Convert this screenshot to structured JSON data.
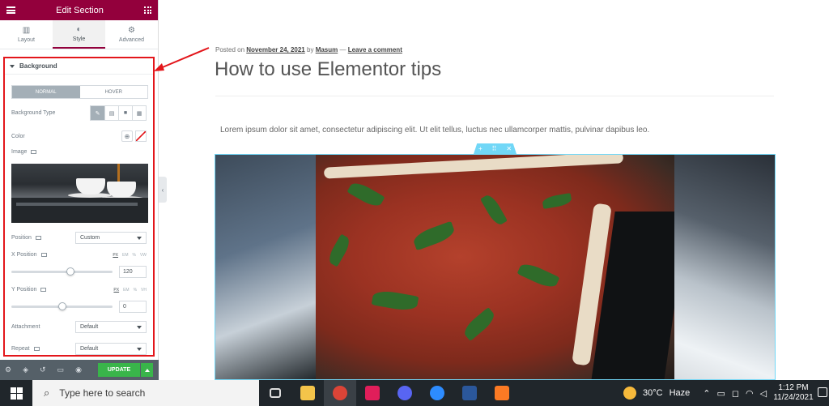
{
  "panel": {
    "header_title": "Edit Section",
    "tabs": [
      {
        "label": "Layout",
        "icon": "layout-icon"
      },
      {
        "label": "Style",
        "icon": "half-circle-icon"
      },
      {
        "label": "Advanced",
        "icon": "gear-icon"
      }
    ],
    "background": {
      "title": "Background",
      "state_tabs": [
        "NORMAL",
        "HOVER"
      ],
      "type_label": "Background Type",
      "color_label": "Color",
      "image_label": "Image",
      "position_label": "Position",
      "position_value": "Custom",
      "x_position_label": "X Position",
      "x_units": [
        "PX",
        "EM",
        "%",
        "VW"
      ],
      "x_value": "120",
      "x_slider_fraction": 0.58,
      "y_position_label": "Y Position",
      "y_units": [
        "PX",
        "EM",
        "%",
        "VH"
      ],
      "y_value": "0",
      "y_slider_fraction": 0.5,
      "attachment_label": "Attachment",
      "attachment_value": "Default",
      "repeat_label": "Repeat",
      "repeat_value": "Default"
    },
    "footer": {
      "update_label": "UPDATE"
    }
  },
  "post": {
    "posted_on": "Posted on",
    "date": "November 24, 2021",
    "by": "by",
    "author": "Masum",
    "dash": "—",
    "comment_link": "Leave a comment",
    "title": "How to use Elementor tips",
    "excerpt": "Lorem ipsum dolor sit amet, consectetur adipiscing elit. Ut elit tellus, luctus nec ullamcorper mattis, pulvinar dapibus leo."
  },
  "taskbar": {
    "search_placeholder": "Type here to search",
    "weather_temp": "30°C",
    "weather_desc": "Haze",
    "time": "1:12 PM",
    "date": "11/24/2021"
  },
  "colors": {
    "panel_header": "#93003c",
    "update_button": "#39b54a",
    "annotation": "#e3161b",
    "section_outline": "#71d7f7"
  }
}
